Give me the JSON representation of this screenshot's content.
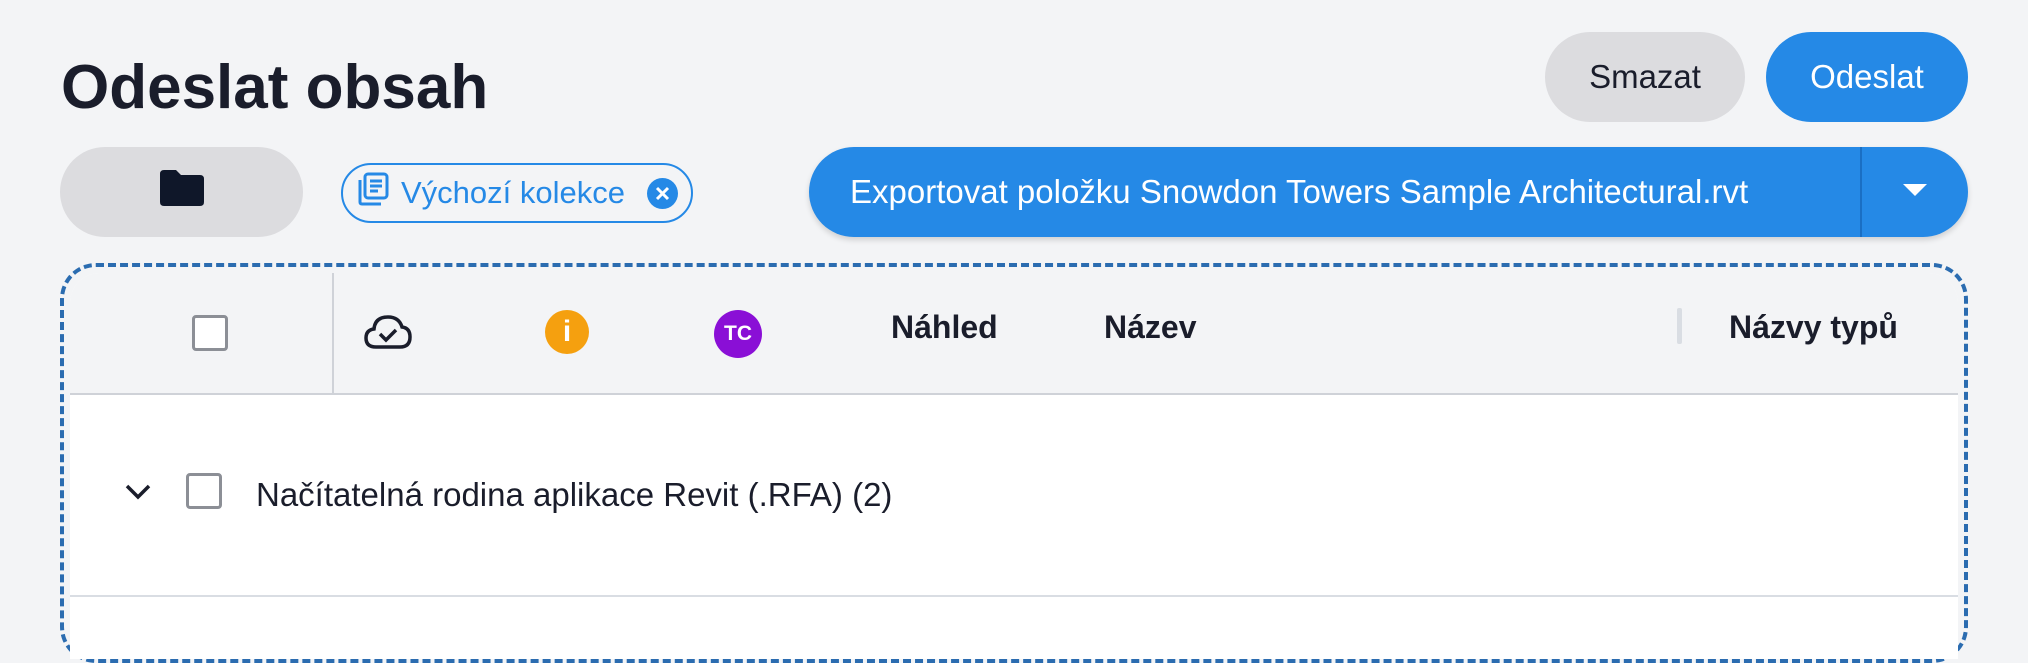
{
  "header": {
    "title": "Odeslat obsah",
    "delete_label": "Smazat",
    "send_label": "Odeslat"
  },
  "toolbar": {
    "folder_icon": "folder-icon",
    "collection_chip": {
      "label": "Výchozí kolekce",
      "icon": "collection-icon",
      "close_icon": "close-icon"
    },
    "export_button": {
      "label": "Exportovat položku Snowdon Towers Sample Architectural.rvt",
      "dropdown_icon": "caret-down-icon"
    }
  },
  "table": {
    "columns": {
      "sync_icon": "cloud-check-icon",
      "info_badge": "i",
      "tc_badge": "TC",
      "preview": "Náhled",
      "name": "Název",
      "type_names": "Názvy typů"
    },
    "rows": [
      {
        "label": "Načítatelná rodina aplikace Revit (.RFA) (2)",
        "expanded": false
      }
    ]
  },
  "colors": {
    "accent": "#2589e6",
    "info_badge": "#f5a00f",
    "tc_badge": "#8a0fd6",
    "background": "#f3f4f6"
  }
}
